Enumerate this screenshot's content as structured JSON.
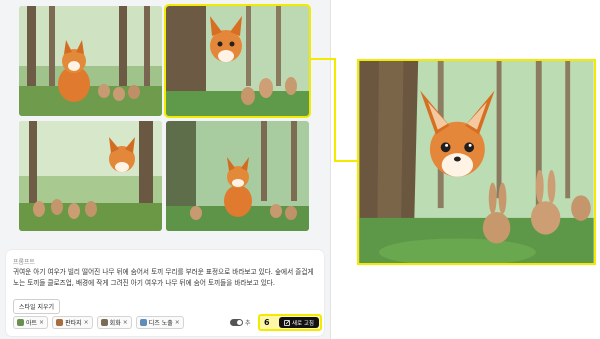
{
  "prompt": {
    "label": "프롬프트",
    "text": "귀여운 아기 여우가 빌리 떨어진 나무 뒤에 숨어서 토끼 무리를 부러운 표정으로 바라보고 있다. 숲에서 즐겁게 노는 토끼들 클로즈업, 배경에 작게 그려진 아기 여우가 나무 뒤에 숨어 토끼들을 바라보고 있다.",
    "style_clear_label": "스타일 지우기",
    "chips": [
      {
        "label": "아트",
        "color": "#6b8f4e"
      },
      {
        "label": "판타지",
        "color": "#a86d3b"
      },
      {
        "label": "회화",
        "color": "#7b6a55"
      },
      {
        "label": "디즈 노출",
        "color": "#5f8cb8"
      }
    ],
    "toggle_label": "추",
    "badge_number": "6",
    "new_button_label": "새로 고침"
  },
  "colors": {
    "highlight": "#f2ea00",
    "button_bg": "#111111"
  },
  "images": [
    {
      "name": "result-image-1",
      "selected": false
    },
    {
      "name": "result-image-2",
      "selected": true
    },
    {
      "name": "result-image-3",
      "selected": false
    },
    {
      "name": "result-image-4",
      "selected": false
    }
  ]
}
